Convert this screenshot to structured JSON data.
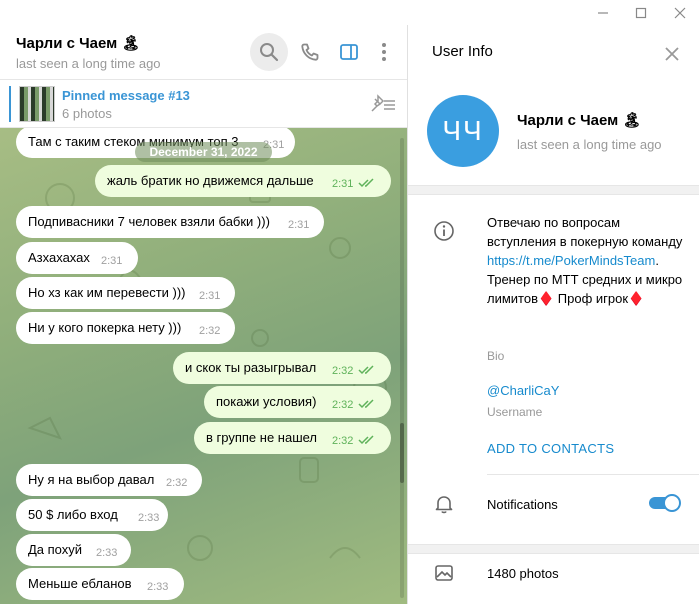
{
  "window": {
    "controls": [
      "minimize-icon",
      "maximize-icon",
      "close-icon"
    ]
  },
  "chat": {
    "name": "Чарли с Чаем 🏝",
    "status": "last seen a long time ago",
    "header_icons": [
      "search-icon",
      "phone-icon",
      "sidebar-icon",
      "more-icon"
    ]
  },
  "pinned": {
    "title": "Pinned message #13",
    "subtitle": "6 photos"
  },
  "date_pill": "December 31, 2022",
  "messages": [
    {
      "dir": "in",
      "text": "Там с таким стеком минимум топ 3",
      "time": "2:31"
    },
    {
      "dir": "out",
      "text": "жаль братик но движемся дальше",
      "time": "2:31"
    },
    {
      "dir": "in",
      "text": "Подпивасники 7 человек взяли бабки )))",
      "time": "2:31"
    },
    {
      "dir": "in",
      "text": "Азхахахах",
      "time": "2:31"
    },
    {
      "dir": "in",
      "text": "Но хз как им перевести )))",
      "time": "2:31"
    },
    {
      "dir": "in",
      "text": "Ни у кого покерка нету )))",
      "time": "2:32"
    },
    {
      "dir": "out",
      "text": "и скок ты разыгрывал",
      "time": "2:32"
    },
    {
      "dir": "out",
      "text": "покажи условия)",
      "time": "2:32"
    },
    {
      "dir": "out",
      "text": "в группе не нашел",
      "time": "2:32"
    },
    {
      "dir": "in",
      "text": "Ну я на выбор давал",
      "time": "2:32"
    },
    {
      "dir": "in",
      "text": "50 $ либо вход",
      "time": "2:33"
    },
    {
      "dir": "in",
      "text": "Да похуй",
      "time": "2:33"
    },
    {
      "dir": "in",
      "text": "Меньше ебланов",
      "time": "2:33"
    }
  ],
  "info": {
    "title": "User Info",
    "avatar_initials": "ЧЧ",
    "avatar_color": "#3a9ee0",
    "name": "Чарли с Чаем 🏝",
    "status": "last seen a long time ago",
    "bio_before": "Отвечаю по вопросам вступления в покерную команду",
    "bio_link": "https://t.me/PokerMindsTeam",
    "bio_after": ". Тренер по МТТ средних и микро лимитов♦️ Проф игрок♦️",
    "bio_label": "Bio",
    "username": "@CharliCaY",
    "username_label": "Username",
    "add_contacts": "ADD TO CONTACTS",
    "notifications_label": "Notifications",
    "notifications_on": true,
    "photos": "1480 photos"
  },
  "colors": {
    "accent": "#3a95d5",
    "link": "#168acd",
    "outgoing_bubble": "#effdde",
    "time_out": "#5fb25a"
  }
}
